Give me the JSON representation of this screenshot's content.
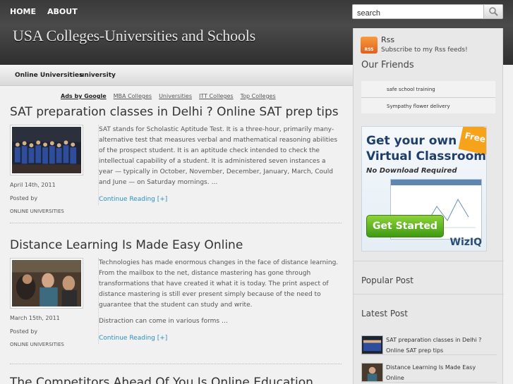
{
  "header": {
    "nav": [
      "HOME",
      "ABOUT"
    ],
    "site_title": "USA Colleges-Universities and Schools",
    "search_value": "search"
  },
  "subnav": {
    "items": [
      "Online Universities",
      "university"
    ]
  },
  "adlinks": {
    "label": "Ads by Google",
    "links": [
      "MBA Colleges",
      "Universities",
      "ITT Colleges",
      "Top Colleges"
    ]
  },
  "posts": [
    {
      "title": "SAT preparation classes in Delhi ? Online SAT prep tips",
      "date": "April 14th, 2011",
      "posted_by": "Posted by",
      "category": "ONLINE UNIVERSITIES",
      "excerpt": "SAT stands for Scholastic Aptitude Test. It is a three-hour, primarily many-alternative test that measures verbal and mathematical reasoning abilities of the prospect student. It is an aptitude check intended to check the intellectual capability of a student. It is administered seven instances a year — typically in October, November, December, January, March, Could and June — on Saturday mornings.  …",
      "more": "Continue Reading [+]"
    },
    {
      "title": "Distance Learning Is Made Easy Online",
      "date": "March 15th, 2011",
      "posted_by": "Posted by",
      "category": "ONLINE UNIVERSITIES",
      "excerpt": "Technologies has made enormous changes in the face of distance learning. From the mailbox to the net, distance mastering has gone through transformations that have created it what it is today. The print aspect of distance mastering is still ever present simply because of the need to guarantee that the student can study and write.",
      "excerpt2": "Distraction can come in various forms …",
      "more": "Continue Reading [+]"
    }
  ],
  "next_title": "The Competitors Ahead Of You Is Online Education",
  "sidebar": {
    "rss_icon_text": "RSS",
    "rss_title": "Rss",
    "rss_sub": "Subscribe to my Rss feeds!",
    "friends_heading": "Our Friends",
    "friends": [
      "safe school training",
      "Sympathy flower delivery"
    ],
    "ad": {
      "line1": "Get your own",
      "line2": "Virtual Classroom",
      "line3": "No Download Required",
      "free": "Free",
      "button": "Get Started",
      "logo": "WizIQ"
    },
    "popular_heading": "Popular Post",
    "latest_heading": "Latest Post",
    "latest": [
      "SAT preparation classes in Delhi ? Online SAT prep tips",
      "Distance Learning Is Made Easy Online"
    ]
  }
}
